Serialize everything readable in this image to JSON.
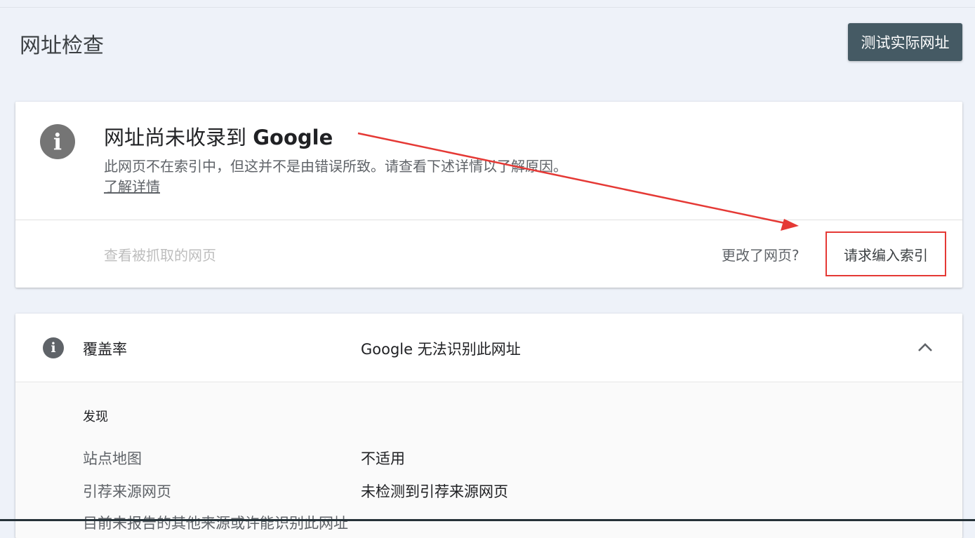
{
  "header": {
    "title": "网址检查",
    "test_live_label": "测试实际网址"
  },
  "status_card": {
    "title_prefix": "网址尚未收录到 ",
    "title_brand": "Google",
    "description": "此网页不在索引中，但这并不是由错误所致。请查看下述详情以了解原因。",
    "learn_more": "了解详情",
    "view_crawled": "查看被抓取的网页",
    "page_changed": "更改了网页?",
    "request_indexing": "请求编入索引"
  },
  "coverage": {
    "label": "覆盖率",
    "status": "Google 无法识别此网址",
    "section_title": "发现",
    "rows": [
      {
        "label": "站点地图",
        "value": "不适用"
      },
      {
        "label": "引荐来源网页",
        "value": "未检测到引荐来源网页"
      },
      {
        "label": "目前未报告的其他来源或许能识别此网址",
        "value": ""
      }
    ]
  },
  "colors": {
    "background": "#eef2f9",
    "button_bg": "#455a64",
    "annotation_red": "#e53935"
  },
  "icons": [
    "info-icon",
    "chevron-up-icon",
    "annotation-arrow"
  ]
}
